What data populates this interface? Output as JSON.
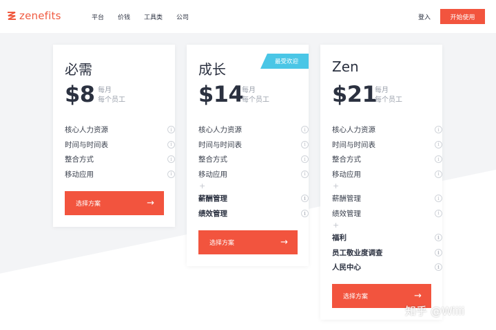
{
  "nav": {
    "logo_text": "zenefits",
    "links": [
      "平台",
      "价钱",
      "工具类",
      "公司"
    ],
    "login": "登入",
    "cta": "开始使用"
  },
  "plans": [
    {
      "name": "必需",
      "price": "$8",
      "unit_line1": "每月",
      "unit_line2": "每个员工",
      "features": [
        "核心人力资源",
        "时间与时间表",
        "整合方式",
        "移动应用"
      ],
      "button": "选择方案"
    },
    {
      "name": "成长",
      "badge": "最受欢迎",
      "price": "$14",
      "unit_line1": "每月",
      "unit_line2": "每个员工",
      "features": [
        "核心人力资源",
        "时间与时间表",
        "整合方式",
        "移动应用"
      ],
      "extra_features": [
        "薪酬管理",
        "绩效管理"
      ],
      "button": "选择方案"
    },
    {
      "name": "Zen",
      "price": "$21",
      "unit_line1": "每月",
      "unit_line2": "每个员工",
      "features": [
        "核心人力资源",
        "时间与时间表",
        "整合方式",
        "移动应用"
      ],
      "extra_features": [
        "薪酬管理",
        "绩效管理"
      ],
      "extra_features_2": [
        "福利",
        "员工敬业度调查",
        "人民中心"
      ],
      "button": "选择方案"
    }
  ],
  "watermark": "知乎 @Wiiii",
  "colors": {
    "accent": "#f2543e",
    "badge": "#4ac6e6",
    "text": "#2b3140"
  },
  "icons": {
    "info": "info-icon",
    "arrow": "arrow-right-icon",
    "plus": "plus-icon"
  }
}
